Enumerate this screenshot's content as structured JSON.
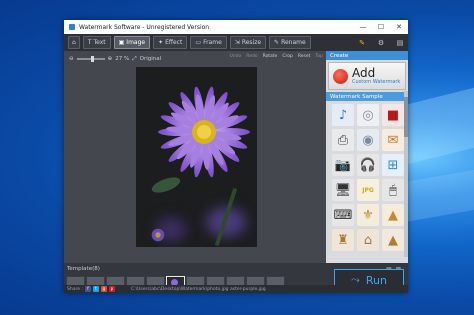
{
  "window": {
    "title": "Watermark Software - Unregistered Version",
    "controls": [
      "—",
      "☐",
      "✕"
    ]
  },
  "toolbar": {
    "tabs": [
      {
        "label": "Text",
        "icon": "T"
      },
      {
        "label": "Image",
        "icon": "▣"
      },
      {
        "label": "Effect",
        "icon": "✦"
      },
      {
        "label": "Frame",
        "icon": "▭"
      },
      {
        "label": "Resize",
        "icon": "⇲"
      },
      {
        "label": "Rename",
        "icon": "✎"
      }
    ],
    "active_tab": "Image"
  },
  "canvas": {
    "zoom_value": "27 %",
    "original_label": "Original",
    "actions": [
      "Undo",
      "Redo",
      "Rotate",
      "Crop",
      "Reset",
      "Top"
    ]
  },
  "side_panel": {
    "create_header": "Create",
    "add_label": "Add",
    "add_sub": "Custom Watermark",
    "sample_header": "Watermark Sample",
    "samples": [
      {
        "icon": "music-note",
        "glyph": "♪",
        "color": "#2f6fd6",
        "bg": "#e6ecf7"
      },
      {
        "icon": "cd-disc",
        "glyph": "◎",
        "color": "#8a8f98",
        "bg": "#eef0f3"
      },
      {
        "icon": "camcorder",
        "glyph": "■",
        "color": "#b31b1b",
        "bg": "#f2e6e6"
      },
      {
        "icon": "printer",
        "glyph": "⎙",
        "color": "#444",
        "bg": "#e9eaec"
      },
      {
        "icon": "disc",
        "glyph": "◉",
        "color": "#7d8a99",
        "bg": "#e7ebf0"
      },
      {
        "icon": "mail",
        "glyph": "✉",
        "color": "#cc7a1c",
        "bg": "#f6ecdf"
      },
      {
        "icon": "camera",
        "glyph": "📷",
        "color": "#333",
        "bg": "#e6e6e6"
      },
      {
        "icon": "headphones",
        "glyph": "🎧",
        "color": "#333",
        "bg": "#e6e6e6"
      },
      {
        "icon": "windows-logo",
        "glyph": "⊞",
        "color": "#2a8ad6",
        "bg": "#e6f0fa"
      },
      {
        "icon": "monitor",
        "glyph": "🖥",
        "color": "#333",
        "bg": "#e6e6e6"
      },
      {
        "icon": "jpg-file",
        "glyph": "JPG",
        "color": "#d8a516",
        "bg": "#f7f0dc"
      },
      {
        "icon": "mouse",
        "glyph": "🖱",
        "color": "#333",
        "bg": "#e6e6e6"
      },
      {
        "icon": "keyboard",
        "glyph": "⌨",
        "color": "#333",
        "bg": "#e6e6e6"
      },
      {
        "icon": "hanger",
        "glyph": "⚜",
        "color": "#b8862c",
        "bg": "#f4eddc"
      },
      {
        "icon": "pyramid",
        "glyph": "▲",
        "color": "#c28a32",
        "bg": "#f4ecdd"
      },
      {
        "icon": "tower",
        "glyph": "♜",
        "color": "#a57a3a",
        "bg": "#efe6d8"
      },
      {
        "icon": "colosseum",
        "glyph": "⌂",
        "color": "#9a7b4f",
        "bg": "#eee5d8"
      },
      {
        "icon": "pyramid-2",
        "glyph": "▲",
        "color": "#b07c36",
        "bg": "#f2e9dc"
      }
    ]
  },
  "template_bar": {
    "label": "Template(8)",
    "run_label": "Run",
    "run_icon": "⤳"
  },
  "status": {
    "share_label": "Share :",
    "share_icons": [
      {
        "glyph": "f",
        "color": "#3b5998"
      },
      {
        "glyph": "t",
        "color": "#1da1f2"
      },
      {
        "glyph": "g",
        "color": "#dd4b39"
      },
      {
        "glyph": "p",
        "color": "#cb2027"
      }
    ],
    "path": "C:\\Users\\abc\\Desktop\\Watermark\\photo.jpg  aster-purple.jpg"
  }
}
